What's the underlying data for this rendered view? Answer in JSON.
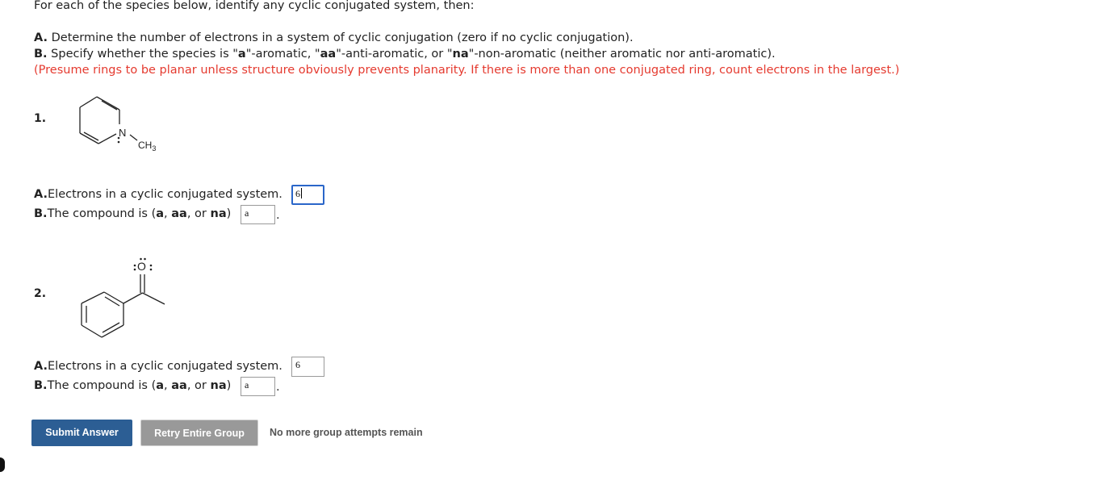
{
  "header": {
    "intro": "For each of the species below, identify any cyclic conjugated system, then:",
    "partA": {
      "label": "A.",
      "text": " Determine the number of electrons in a system of cyclic conjugation (zero if no cyclic conjugation)."
    },
    "partB": {
      "label": "B.",
      "t1": " Specify whether the species is \"",
      "a": "a",
      "t2": "\"-aromatic, \"",
      "aa": "aa",
      "t3": "\"-anti-aromatic, or \"",
      "na": "na",
      "t4": "\"-non-aromatic (neither aromatic nor anti-aromatic)."
    },
    "note": "(Presume rings to be planar unless structure obviously prevents planarity. If there is more than one conjugated ring, count electrons in the largest.)"
  },
  "questions": [
    {
      "number": "1.",
      "structure_labels": {
        "heteroatom": "N",
        "substituent": "CH",
        "subscript": "3"
      },
      "a_label": "A.",
      "a_text": "Electrons in a cyclic conjugated system.",
      "a_value": "6",
      "b_label": "B.",
      "b_text_pre": "The compound is (",
      "b_a": "a",
      "b_sep1": ", ",
      "b_aa": "aa",
      "b_sep2": ", or ",
      "b_na": "na",
      "b_close": ")",
      "b_value": "a",
      "b_end": "."
    },
    {
      "number": "2.",
      "structure_labels": {
        "heteroatom": "O"
      },
      "a_label": "A.",
      "a_text": "Electrons in a cyclic conjugated system.",
      "a_value": "6",
      "b_label": "B.",
      "b_text_pre": "The compound is (",
      "b_a": "a",
      "b_sep1": ", ",
      "b_aa": "aa",
      "b_sep2": ", or ",
      "b_na": "na",
      "b_close": ")",
      "b_value": "a",
      "b_end": "."
    }
  ],
  "actions": {
    "submit": "Submit Answer",
    "retry": "Retry Entire Group",
    "status": "No more group attempts remain"
  },
  "colors": {
    "note": "#e53a2f",
    "primary_button": "#2c5e94",
    "secondary_button": "#999999",
    "focus_border": "#2a66c9"
  }
}
